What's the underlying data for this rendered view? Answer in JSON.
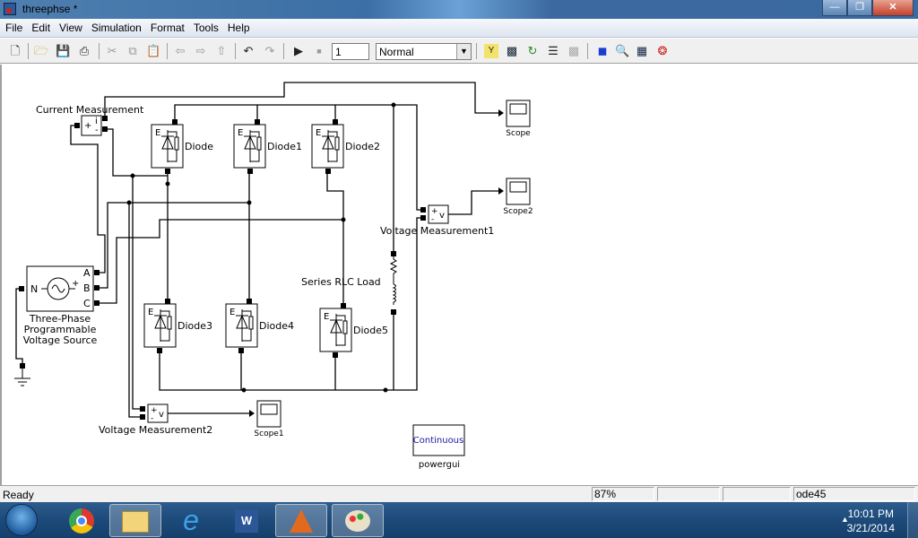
{
  "window": {
    "title": "threephse *",
    "controls": [
      "minimize",
      "restore",
      "close"
    ]
  },
  "menu": [
    "File",
    "Edit",
    "View",
    "Simulation",
    "Format",
    "Tools",
    "Help"
  ],
  "toolbar": {
    "icons": [
      "new-icon",
      "open-icon",
      "save-icon",
      "print-icon",
      "cut-icon",
      "copy-icon",
      "paste-icon",
      "back-icon",
      "forward-icon",
      "up-icon",
      "undo-icon",
      "redo-icon",
      "start-simulation-icon",
      "stop-simulation-icon"
    ],
    "stop_time": "1",
    "sim_mode": "Normal",
    "right_icons": [
      "build-icon",
      "update-diagram-icon",
      "refresh-icon",
      "load-icon",
      "build-all-icon",
      "library-browser-icon",
      "model-explorer-icon",
      "debugger-icon",
      "profiler-icon"
    ]
  },
  "diagram": {
    "current_measurement": {
      "label": "Current Measurement",
      "plus": "+",
      "signal": "i",
      "minus": "-"
    },
    "diodes": [
      "Diode",
      "Diode1",
      "Diode2",
      "Diode3",
      "Diode4",
      "Diode5"
    ],
    "diode_port_letter": "E",
    "source": {
      "line1": "Three-Phase",
      "line2": "Programmable",
      "line3": "Voltage Source",
      "ports": [
        "A",
        "B",
        "C"
      ],
      "neutral": "N",
      "plus": "+"
    },
    "vm1": {
      "label": "Voltage Measurement1",
      "plus": "+",
      "minus": "-",
      "signal": "v"
    },
    "vm2": {
      "label": "Voltage Measurement2",
      "plus": "+",
      "minus": "-",
      "signal": "v"
    },
    "rlc_label": "Series RLC Load",
    "scopes": [
      "Scope",
      "Scope2",
      "Scope1"
    ],
    "powergui": {
      "text": "Continuous",
      "label": "powergui",
      "text_color": "#1a1aa0"
    }
  },
  "status": {
    "text": "Ready",
    "zoom": "87%",
    "cell3": "",
    "cell4": "",
    "solver": "ode45"
  },
  "taskbar": {
    "apps": [
      "chrome",
      "file-explorer",
      "internet-explorer",
      "word",
      "matlab",
      "paint"
    ],
    "active": "matlab",
    "time": "10:01 PM",
    "date": "3/21/2014"
  }
}
